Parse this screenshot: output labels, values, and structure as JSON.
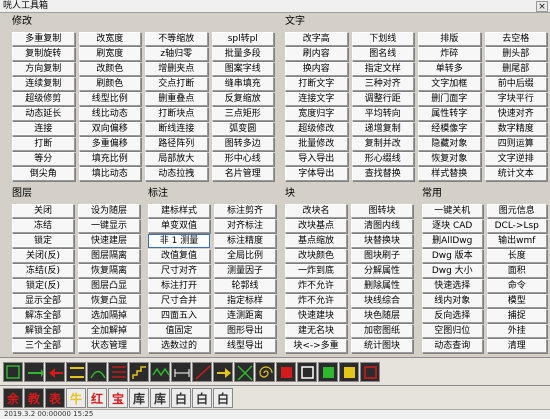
{
  "window": {
    "title": "咣人工具箱",
    "close_label": "×"
  },
  "groups": {
    "modify": {
      "title": "修改",
      "buttons": [
        "多重复制",
        "改宽度",
        "不等缩放",
        "spl转pl",
        "复制旋转",
        "刷宽度",
        "z轴归零",
        "批量多段",
        "方向复制",
        "改颜色",
        "增删夹点",
        "图案字线",
        "连续复制",
        "刷颜色",
        "交点打断",
        "缝串填充",
        "超级修剪",
        "线型比例",
        "删重叠点",
        "反复缩放",
        "动态延长",
        "线比动态",
        "打断块点",
        "三点矩形",
        "连接",
        "双向偏移",
        "断线连接",
        "弧变圆",
        "打断",
        "多重偏移",
        "路径阵列",
        "图转多边",
        "等分",
        "填充比例",
        "局部放大",
        "形中心线",
        "倒尖角",
        "填比动态",
        "动态拉拽",
        "名片管理"
      ]
    },
    "text": {
      "title": "文字",
      "buttons": [
        "改字高",
        "下划线",
        "排版",
        "去空格",
        "刷内容",
        "图名线",
        "炸碎",
        "删头部",
        "换内容",
        "指定文样",
        "单转多",
        "删尾部",
        "打断文字",
        "三种对齐",
        "文字加框",
        "前中后缀",
        "连接文字",
        "调整行距",
        "删门面字",
        "字块平行",
        "宽度归字",
        "平均转向",
        "属性转字",
        "快速对齐",
        "超级修改",
        "递增复制",
        "经模像字",
        "数字精度",
        "批量修改",
        "复制并改",
        "隐藏对象",
        "四则运算",
        "导入导出",
        "形心缀线",
        "恢复对象",
        "文字逆排",
        "字体导出",
        "查找替换",
        "样式替换",
        "统计文本"
      ]
    },
    "layer": {
      "title": "图层",
      "buttons": [
        "关闭",
        "设为随层",
        "冻结",
        "一键显示",
        "锁定",
        "快速建层",
        "关闭(反)",
        "图层隔离",
        "冻结(反)",
        "恢复隔离",
        "锁定(反)",
        "图层凸显",
        "显示全部",
        "恢复凸显",
        "解冻全部",
        "选加隔掉",
        "解锁全部",
        "全加解掉",
        "三个全部",
        "状态管理"
      ]
    },
    "annotate": {
      "title": "标注",
      "buttons": [
        "建标样式",
        "标注剪齐",
        "单变双值",
        "对齐标注",
        "非 1 测量",
        "标注精度",
        "改值复值",
        "全局比例",
        "尺寸对齐",
        "测量因子",
        "标注打开",
        "轮郭线",
        "尺寸合并",
        "指定标样",
        "四面五入",
        "连测距离",
        "值固定",
        "图形导出",
        "选数过的",
        "线型导出"
      ]
    },
    "block": {
      "title": "块",
      "buttons": [
        "改块名",
        "图转块",
        "改块基点",
        "清图内线",
        "基点缩放",
        "块替换块",
        "改块颜色",
        "图块刷子",
        "一炸到底",
        "分解属性",
        "炸不允许",
        "删除属性",
        "炸不允许",
        "块线综合",
        "快速建块",
        "块色随层",
        "建无名块",
        "加密图纸",
        "块<->多重",
        "统计图块"
      ]
    },
    "common": {
      "title": "常用",
      "buttons": [
        "一键关机",
        "图元信息",
        "逐块 CAD",
        "DCL->Lsp",
        "删AllDwg",
        "输出wmf",
        "Dwg 版本",
        "长度",
        "Dwg 大小",
        "面积",
        "快速选择",
        "命令",
        "线内对象",
        "模型",
        "反向选择",
        "捕捉",
        "空图归位",
        "外挂",
        "动态查询",
        "清理"
      ]
    }
  },
  "toolbar1": {
    "icons": [
      "coord-icon",
      "arrow-bar-icon",
      "arrow-left-icon",
      "bar-icon",
      "arc-icon",
      "grid-icon",
      "stairs-icon",
      "zigzag-icon",
      "dim-icon",
      "line-icon",
      "arrow-right-icon",
      "diag-icon",
      "spiral-icon",
      "sq-icon",
      "sq-icon",
      "sq-icon",
      "sq-icon",
      "sq-icon"
    ]
  },
  "toolbar2": {
    "labels": [
      "余",
      "教",
      "表",
      "牛",
      "红",
      "宝",
      "库",
      "库",
      "白",
      "白",
      "白"
    ]
  },
  "statusbar": {
    "text": "2019.3.2 00:00000 15:25"
  },
  "colors": {
    "accent": "#3c6fb6",
    "toolbar_dark": "#2b2b2b",
    "red": "#d51a1a",
    "green": "#2db82d",
    "yellow": "#e6c51a"
  }
}
